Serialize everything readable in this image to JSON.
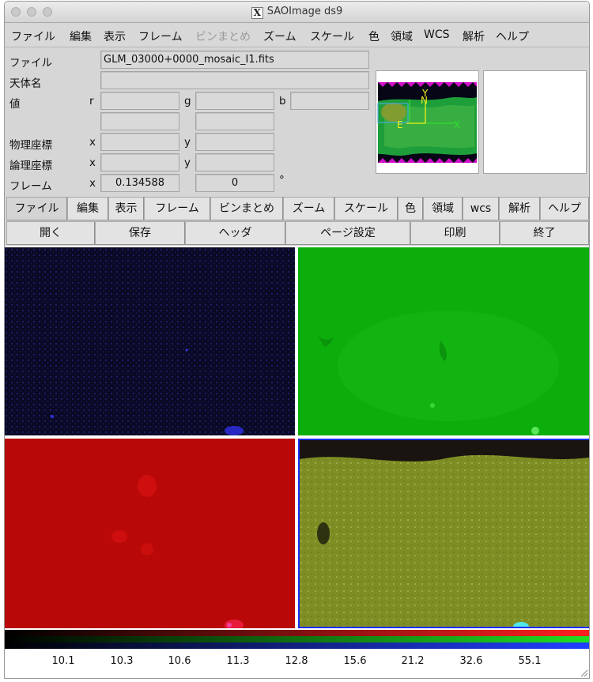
{
  "window": {
    "title": "SAOImage ds9",
    "logo_letter": "X"
  },
  "menubar": [
    {
      "label": "ファイル",
      "enabled": true
    },
    {
      "label": "編集",
      "enabled": true
    },
    {
      "label": "表示",
      "enabled": true
    },
    {
      "label": "フレーム",
      "enabled": true
    },
    {
      "label": "ビンまとめ",
      "enabled": false
    },
    {
      "label": "ズーム",
      "enabled": true
    },
    {
      "label": "スケール",
      "enabled": true
    },
    {
      "label": "色",
      "enabled": true
    },
    {
      "label": "領域",
      "enabled": true
    },
    {
      "label": "WCS",
      "enabled": true
    },
    {
      "label": "解析",
      "enabled": true
    },
    {
      "label": "ヘルプ",
      "enabled": true
    }
  ],
  "info": {
    "file_label": "ファイル",
    "file_value": "GLM_03000+0000_mosaic_I1.fits",
    "object_label": "天体名",
    "object_value": "",
    "value_label": "値",
    "r_label": "r",
    "g_label": "g",
    "b_label": "b",
    "physical_label": "物理座標",
    "logical_label": "論理座標",
    "frame_label": "フレーム",
    "x_label": "x",
    "y_label": "y",
    "frame_x_value": "0.134588",
    "frame_y_value": "0",
    "degree_symbol": "°"
  },
  "panner": {
    "compass_y": "Y",
    "compass_n": "N",
    "compass_e": "E",
    "compass_x": "X",
    "compass_color": "#f0f020",
    "compass_green": "#30e030"
  },
  "buttonbar": [
    {
      "label": "ファイル",
      "active": true
    },
    {
      "label": "編集"
    },
    {
      "label": "表示"
    },
    {
      "label": "フレーム"
    },
    {
      "label": "ビンまとめ"
    },
    {
      "label": "ズーム"
    },
    {
      "label": "スケール"
    },
    {
      "label": "色"
    },
    {
      "label": "領域"
    },
    {
      "label": "wcs"
    },
    {
      "label": "解析"
    },
    {
      "label": "ヘルプ"
    }
  ],
  "subbuttons": [
    {
      "label": "開く"
    },
    {
      "label": "保存"
    },
    {
      "label": "ヘッダ"
    },
    {
      "label": "ページ設定"
    },
    {
      "label": "印刷"
    },
    {
      "label": "終了"
    }
  ],
  "frames": {
    "blue_frame_color": "#0a0a26",
    "green_frame_color": "#0cae0c",
    "red_frame_color": "#b80808",
    "rgb_frame_color": "#7e8e24",
    "current_frame_border": "#1a2cf0"
  },
  "colorbar": {
    "ticks": [
      "10.1",
      "10.3",
      "10.6",
      "11.3",
      "12.8",
      "15.6",
      "21.2",
      "32.6",
      "55.1"
    ]
  }
}
